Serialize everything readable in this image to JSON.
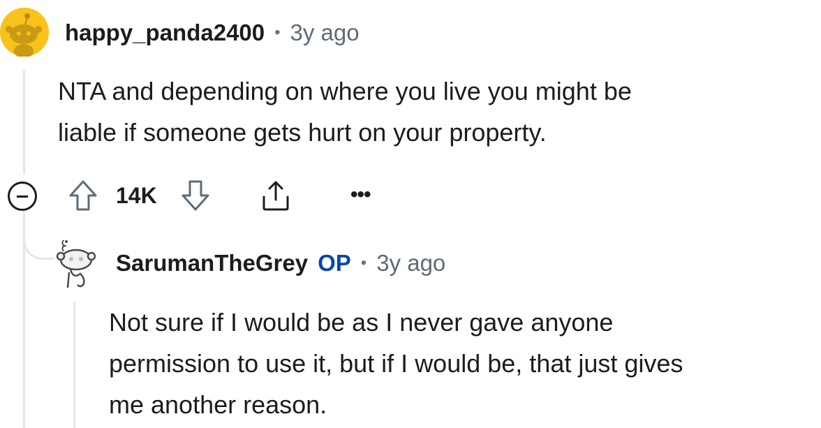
{
  "comment": {
    "username": "happy_panda2400",
    "separator": "•",
    "age": "3y ago",
    "body_lines": [
      "NTA and depending on where you live you might be",
      "liable if someone gets hurt on your property."
    ],
    "score": "14K",
    "more_label": "•••",
    "icons": {
      "avatar": "snoo-avatar-icon",
      "collapse": "minus-circle-icon",
      "upvote": "arrow-up-icon",
      "downvote": "arrow-down-icon",
      "share": "share-icon"
    }
  },
  "reply": {
    "username": "SarumanTheGrey",
    "badge": "OP",
    "separator": "•",
    "age": "3y ago",
    "body_lines": [
      "Not sure if I would be as I never gave anyone",
      "permission to use it, but if I would be, that just gives",
      "me another reason."
    ],
    "icons": {
      "avatar": "snoo-avatar-icon"
    }
  },
  "colors": {
    "avatar_yellow": "#f9c21a",
    "op_blue": "#0a45b0",
    "meta_gray": "#5c6b77",
    "thread_line": "#e4e7ea"
  }
}
